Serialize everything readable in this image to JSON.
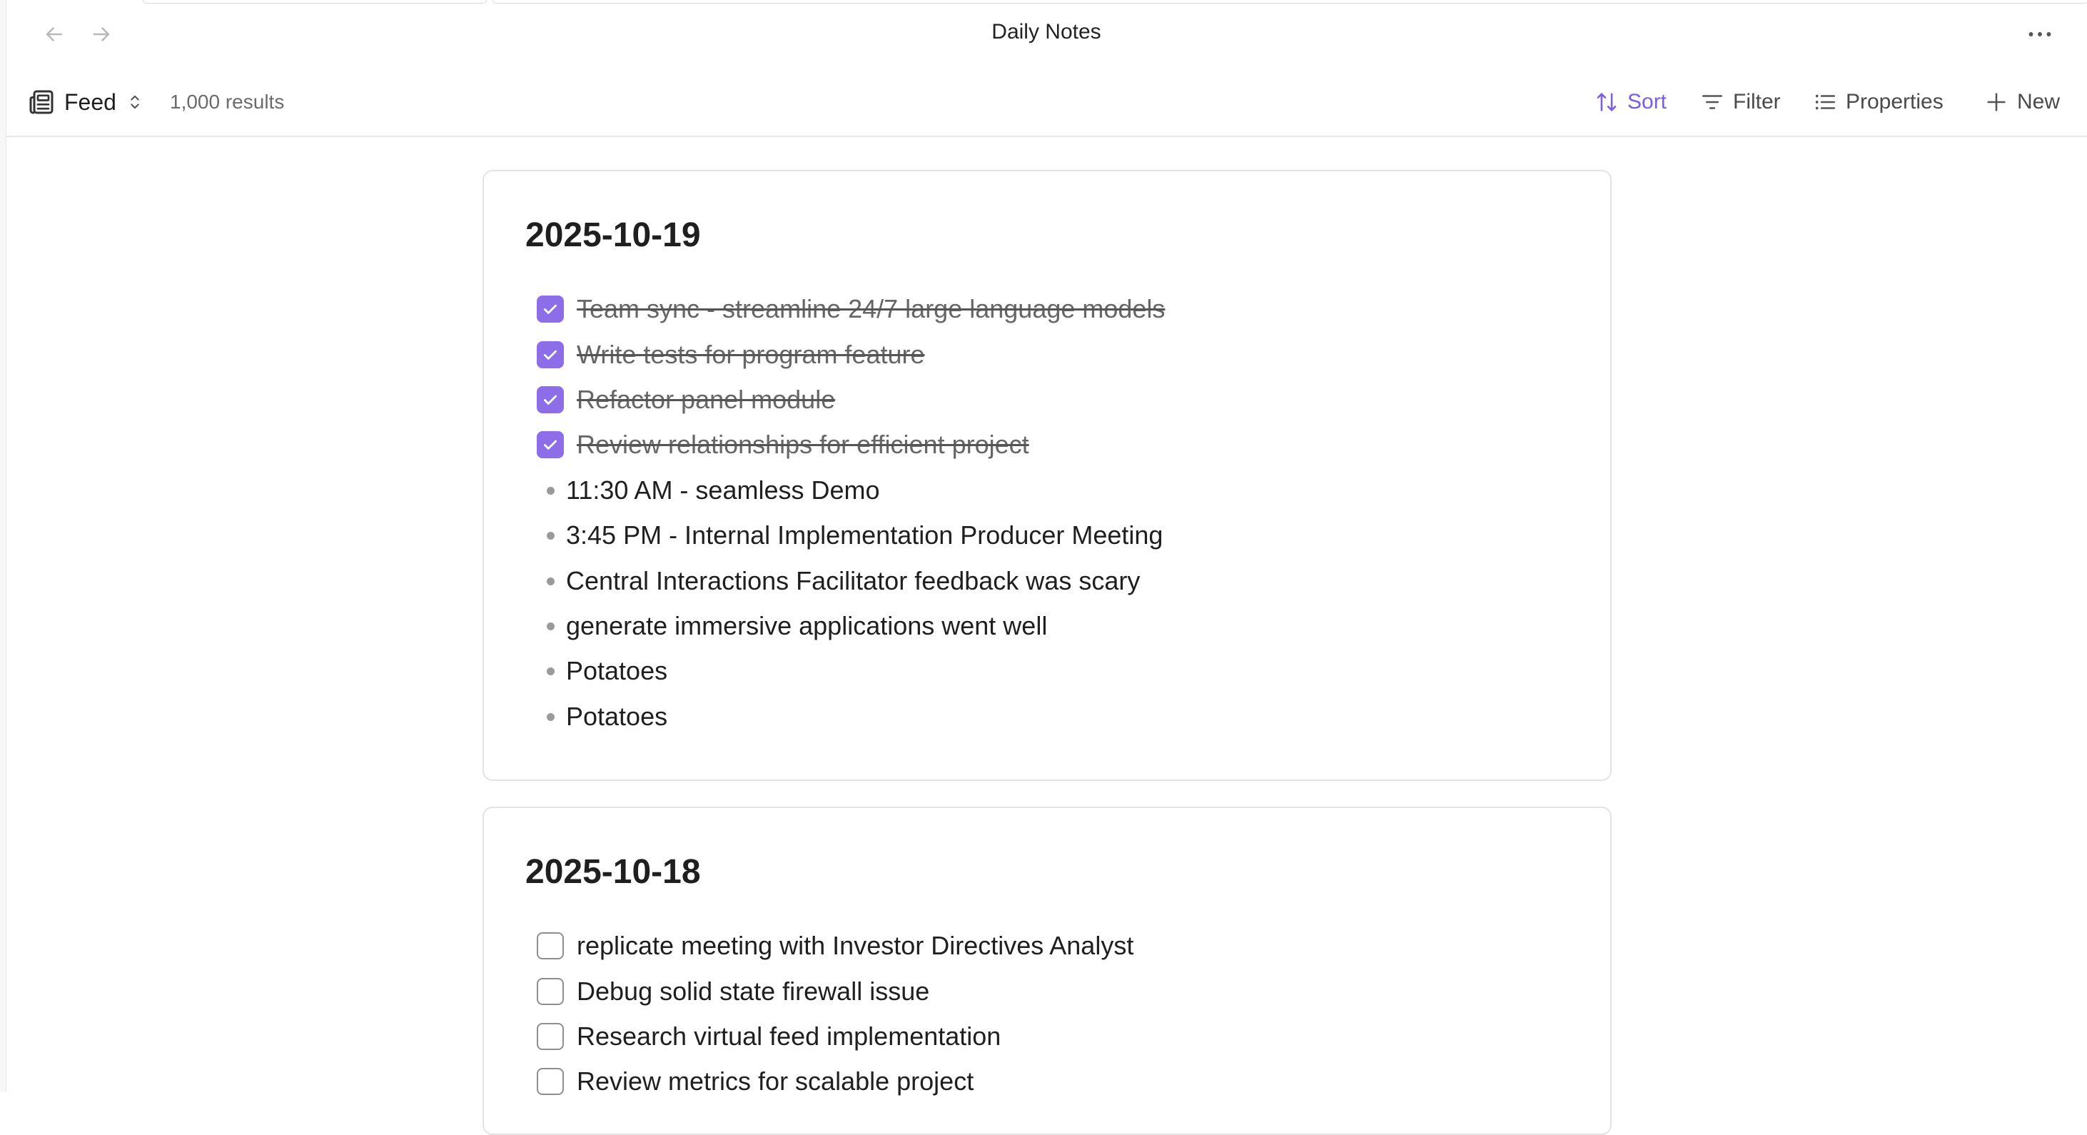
{
  "window": {
    "title": "Daily Notes",
    "back_icon": "arrow-left-icon",
    "forward_icon": "arrow-right-icon",
    "more_icon": "ellipsis-icon"
  },
  "toolbar": {
    "view_label": "Feed",
    "results": "1,000 results",
    "sort_label": "Sort",
    "filter_label": "Filter",
    "properties_label": "Properties",
    "new_label": "New",
    "accent_color": "#7c5ce6"
  },
  "notes": [
    {
      "date": "2025-10-19",
      "tasks": [
        {
          "text": "Team sync - streamline 24/7 large language models",
          "done": true
        },
        {
          "text": "Write tests for program feature",
          "done": true
        },
        {
          "text": "Refactor panel module",
          "done": true
        },
        {
          "text": "Review relationships for efficient project",
          "done": true
        }
      ],
      "bullets": [
        "11:30 AM - seamless Demo",
        "3:45 PM - Internal Implementation Producer Meeting",
        "Central Interactions Facilitator feedback was scary",
        "generate immersive applications went well",
        "Potatoes",
        "Potatoes"
      ]
    },
    {
      "date": "2025-10-18",
      "tasks": [
        {
          "text": "replicate meeting with Investor Directives Analyst",
          "done": false
        },
        {
          "text": "Debug solid state firewall issue",
          "done": false
        },
        {
          "text": "Research virtual feed implementation",
          "done": false
        },
        {
          "text": "Review metrics for scalable project",
          "done": false
        }
      ]
    }
  ]
}
